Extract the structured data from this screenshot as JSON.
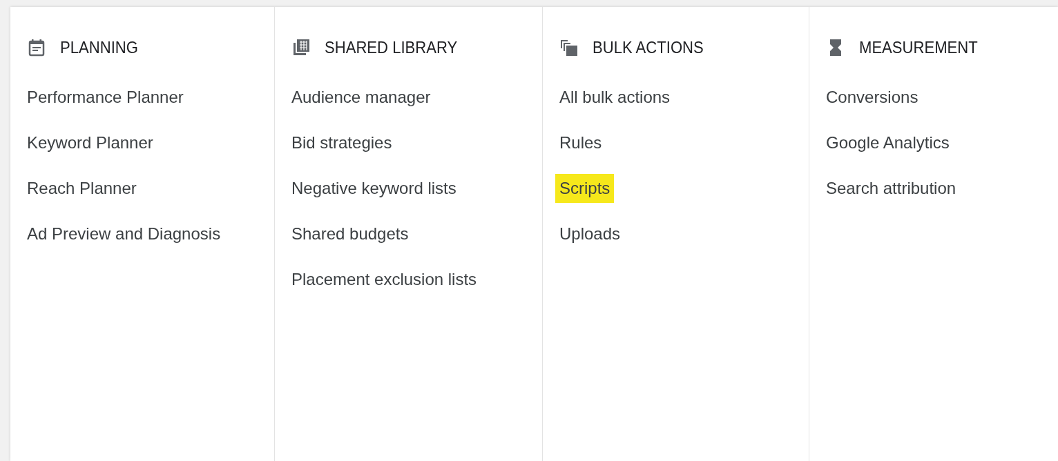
{
  "columns": [
    {
      "title": "PLANNING",
      "items": [
        {
          "label": "Performance Planner",
          "highlighted": false
        },
        {
          "label": "Keyword Planner",
          "highlighted": false
        },
        {
          "label": "Reach Planner",
          "highlighted": false
        },
        {
          "label": "Ad Preview and Diagnosis",
          "highlighted": false
        }
      ]
    },
    {
      "title": "SHARED LIBRARY",
      "items": [
        {
          "label": "Audience manager",
          "highlighted": false
        },
        {
          "label": "Bid strategies",
          "highlighted": false
        },
        {
          "label": "Negative keyword lists",
          "highlighted": false
        },
        {
          "label": "Shared budgets",
          "highlighted": false
        },
        {
          "label": "Placement exclusion lists",
          "highlighted": false
        }
      ]
    },
    {
      "title": "BULK ACTIONS",
      "items": [
        {
          "label": "All bulk actions",
          "highlighted": false
        },
        {
          "label": "Rules",
          "highlighted": false
        },
        {
          "label": "Scripts",
          "highlighted": true
        },
        {
          "label": "Uploads",
          "highlighted": false
        }
      ]
    },
    {
      "title": "MEASUREMENT",
      "items": [
        {
          "label": "Conversions",
          "highlighted": false
        },
        {
          "label": "Google Analytics",
          "highlighted": false
        },
        {
          "label": "Search attribution",
          "highlighted": false
        }
      ]
    }
  ]
}
